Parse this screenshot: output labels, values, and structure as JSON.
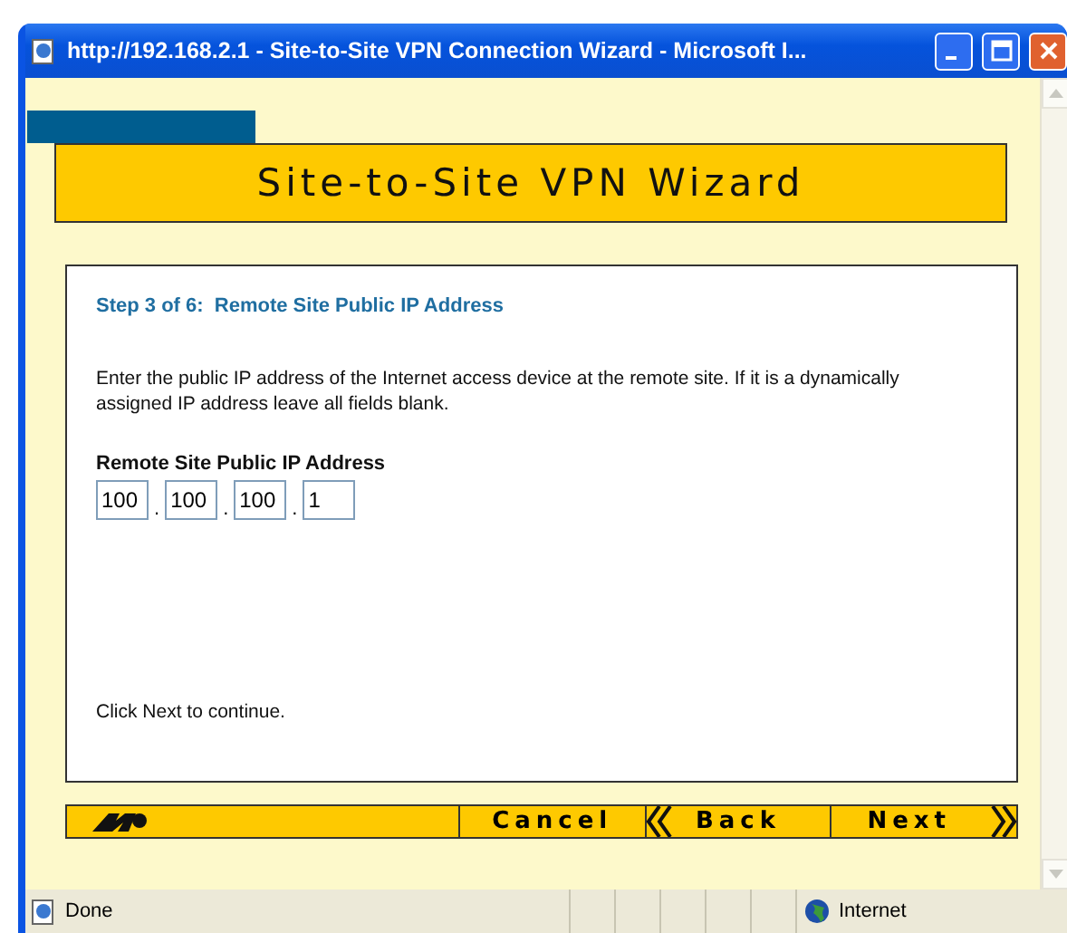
{
  "window": {
    "title": "http://192.168.2.1 - Site-to-Site VPN Connection Wizard - Microsoft I..."
  },
  "banner": {
    "title": "Site-to-Site VPN Wizard"
  },
  "step": {
    "heading": "Step 3 of 6:  Remote Site Public IP Address",
    "description": "Enter the public IP address of the Internet access device at the remote site. If it is a dynamically assigned IP address leave all fields blank.",
    "field_label": "Remote Site Public IP Address",
    "octets": [
      "100",
      "100",
      "100",
      "1"
    ],
    "separator": ".",
    "footer": "Click Next to continue."
  },
  "buttons": [
    {
      "kind": "cancel",
      "label": "Cancel"
    },
    {
      "kind": "back",
      "label": "Back"
    },
    {
      "kind": "next",
      "label": "Next"
    }
  ],
  "status_bar": {
    "status": "Done",
    "zone": "Internet"
  }
}
